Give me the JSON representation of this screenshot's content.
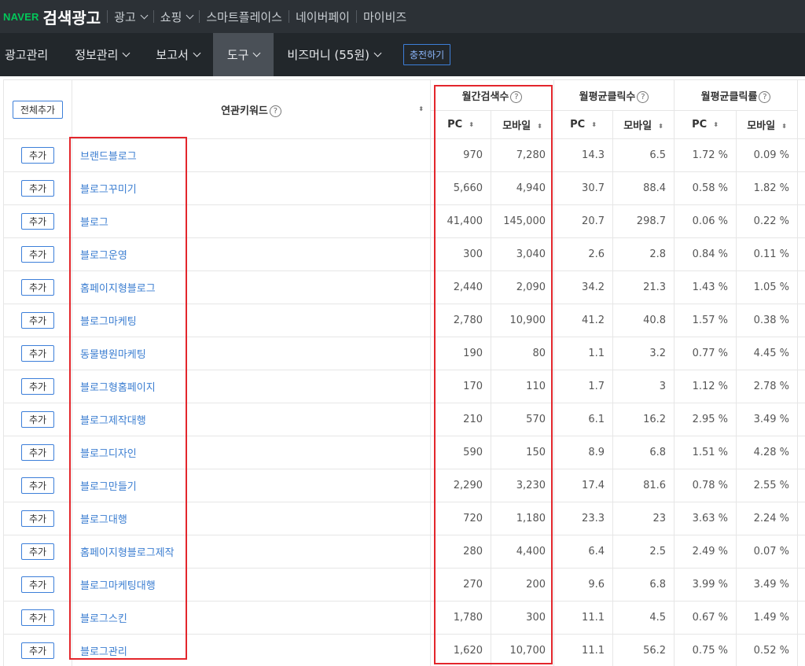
{
  "topbar": {
    "logo_brand": "NAVER",
    "logo_title": "검색광고",
    "menu": [
      {
        "label": "광고",
        "dropdown": true
      },
      {
        "label": "쇼핑",
        "dropdown": true
      },
      {
        "label": "스마트플레이스",
        "dropdown": false
      },
      {
        "label": "네이버페이",
        "dropdown": false
      },
      {
        "label": "마이비즈",
        "dropdown": false
      }
    ]
  },
  "navbar": {
    "items": [
      {
        "label": "광고관리",
        "dropdown": false,
        "active": false
      },
      {
        "label": "정보관리",
        "dropdown": true,
        "active": false
      },
      {
        "label": "보고서",
        "dropdown": true,
        "active": false
      },
      {
        "label": "도구",
        "dropdown": true,
        "active": true
      },
      {
        "label": "비즈머니 (55원)",
        "dropdown": true,
        "active": false
      }
    ],
    "charge_button": "충전하기"
  },
  "table": {
    "add_all_button": "전체추가",
    "col_keyword": "연관키워드",
    "group_search": "월간검색수",
    "group_clicks": "월평균클릭수",
    "group_ctr": "월평균클릭률",
    "sub_pc": "PC",
    "sub_mobile": "모바일",
    "add_label": "추가",
    "help_icon_glyph": "?",
    "sort_glyph": "⬍",
    "rows": [
      {
        "keyword": "브랜드블로그",
        "search_pc": "970",
        "search_mobile": "7,280",
        "click_pc": "14.3",
        "click_mobile": "6.5",
        "ctr_pc": "1.72 %",
        "ctr_mobile": "0.09 %"
      },
      {
        "keyword": "블로그꾸미기",
        "search_pc": "5,660",
        "search_mobile": "4,940",
        "click_pc": "30.7",
        "click_mobile": "88.4",
        "ctr_pc": "0.58 %",
        "ctr_mobile": "1.82 %"
      },
      {
        "keyword": "블로그",
        "search_pc": "41,400",
        "search_mobile": "145,000",
        "click_pc": "20.7",
        "click_mobile": "298.7",
        "ctr_pc": "0.06 %",
        "ctr_mobile": "0.22 %"
      },
      {
        "keyword": "블로그운영",
        "search_pc": "300",
        "search_mobile": "3,040",
        "click_pc": "2.6",
        "click_mobile": "2.8",
        "ctr_pc": "0.84 %",
        "ctr_mobile": "0.11 %"
      },
      {
        "keyword": "홈페이지형블로그",
        "search_pc": "2,440",
        "search_mobile": "2,090",
        "click_pc": "34.2",
        "click_mobile": "21.3",
        "ctr_pc": "1.43 %",
        "ctr_mobile": "1.05 %"
      },
      {
        "keyword": "블로그마케팅",
        "search_pc": "2,780",
        "search_mobile": "10,900",
        "click_pc": "41.2",
        "click_mobile": "40.8",
        "ctr_pc": "1.57 %",
        "ctr_mobile": "0.38 %"
      },
      {
        "keyword": "동물병원마케팅",
        "search_pc": "190",
        "search_mobile": "80",
        "click_pc": "1.1",
        "click_mobile": "3.2",
        "ctr_pc": "0.77 %",
        "ctr_mobile": "4.45 %"
      },
      {
        "keyword": "블로그형홈페이지",
        "search_pc": "170",
        "search_mobile": "110",
        "click_pc": "1.7",
        "click_mobile": "3",
        "ctr_pc": "1.12 %",
        "ctr_mobile": "2.78 %"
      },
      {
        "keyword": "블로그제작대행",
        "search_pc": "210",
        "search_mobile": "570",
        "click_pc": "6.1",
        "click_mobile": "16.2",
        "ctr_pc": "2.95 %",
        "ctr_mobile": "3.49 %"
      },
      {
        "keyword": "블로그디자인",
        "search_pc": "590",
        "search_mobile": "150",
        "click_pc": "8.9",
        "click_mobile": "6.8",
        "ctr_pc": "1.51 %",
        "ctr_mobile": "4.28 %"
      },
      {
        "keyword": "블로그만들기",
        "search_pc": "2,290",
        "search_mobile": "3,230",
        "click_pc": "17.4",
        "click_mobile": "81.6",
        "ctr_pc": "0.78 %",
        "ctr_mobile": "2.55 %"
      },
      {
        "keyword": "블로그대행",
        "search_pc": "720",
        "search_mobile": "1,180",
        "click_pc": "23.3",
        "click_mobile": "23",
        "ctr_pc": "3.63 %",
        "ctr_mobile": "2.24 %"
      },
      {
        "keyword": "홈페이지형블로그제작",
        "search_pc": "280",
        "search_mobile": "4,400",
        "click_pc": "6.4",
        "click_mobile": "2.5",
        "ctr_pc": "2.49 %",
        "ctr_mobile": "0.07 %"
      },
      {
        "keyword": "블로그마케팅대행",
        "search_pc": "270",
        "search_mobile": "200",
        "click_pc": "9.6",
        "click_mobile": "6.8",
        "ctr_pc": "3.99 %",
        "ctr_mobile": "3.49 %"
      },
      {
        "keyword": "블로그스킨",
        "search_pc": "1,780",
        "search_mobile": "300",
        "click_pc": "11.1",
        "click_mobile": "4.5",
        "ctr_pc": "0.67 %",
        "ctr_mobile": "1.49 %"
      },
      {
        "keyword": "블로그관리",
        "search_pc": "1,620",
        "search_mobile": "10,700",
        "click_pc": "11.1",
        "click_mobile": "56.2",
        "ctr_pc": "0.75 %",
        "ctr_mobile": "0.52 %"
      }
    ]
  },
  "colors": {
    "topbar_bg": "#2c3136",
    "navbar_bg": "#22272b",
    "nav_active_bg": "#4a5057",
    "naver_green": "#03c75a",
    "link_blue": "#3b7ed1",
    "button_border": "#3d7fd9",
    "highlight_red": "#e3262c"
  }
}
